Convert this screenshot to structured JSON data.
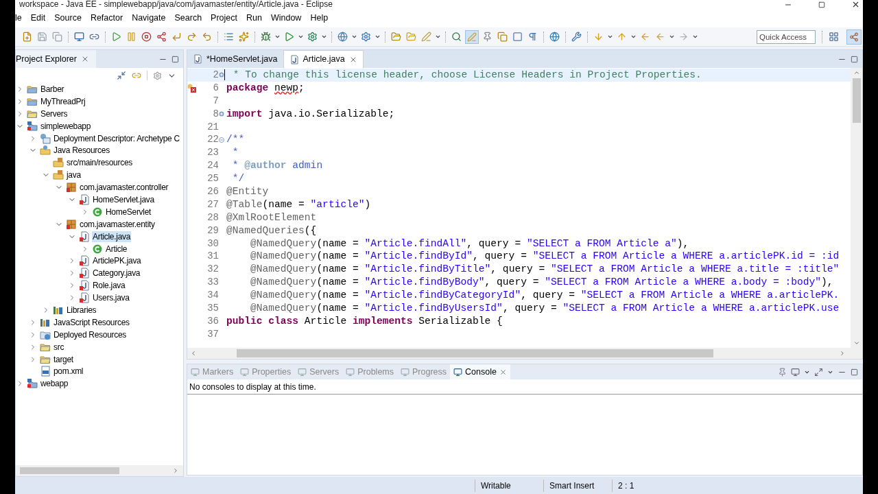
{
  "window": {
    "title": "workspace - Java EE - simplewebapp/java/com/javamaster/entity/Article.java - Eclipse"
  },
  "menu": [
    "le",
    "Edit",
    "Source",
    "Refactor",
    "Navigate",
    "Search",
    "Project",
    "Run",
    "Window",
    "Help"
  ],
  "toolbar": {
    "quick_access": {
      "placeholder": "Quick Access"
    },
    "toggle_buttons": [
      {
        "on": true
      },
      {
        "on": true
      }
    ]
  },
  "project_explorer": {
    "title": "Project Explorer",
    "tree": [
      {
        "label": "Barber",
        "kind": "project",
        "expanded": false,
        "selected": false
      },
      {
        "label": "MyThreadPrj",
        "kind": "project",
        "expanded": false,
        "selected": false
      },
      {
        "label": "Servers",
        "kind": "folder",
        "expanded": false,
        "selected": false
      },
      {
        "label": "simplewebapp",
        "kind": "web-project",
        "expanded": true,
        "selected": false,
        "children": [
          {
            "label": "Deployment Descriptor: Archetype C",
            "kind": "descriptor",
            "expanded": false,
            "selected": false
          },
          {
            "label": "Java Resources",
            "kind": "resources",
            "expanded": true,
            "selected": false,
            "children": [
              {
                "label": "src/main/resources",
                "kind": "source-folder",
                "selected": false
              },
              {
                "label": "java",
                "kind": "source-folder",
                "expanded": true,
                "selected": false,
                "children": [
                  {
                    "label": "com.javamaster.controller",
                    "kind": "package",
                    "expanded": true,
                    "selected": false,
                    "children": [
                      {
                        "label": "HomeServlet.java",
                        "kind": "java-file",
                        "expanded": true,
                        "selected": false,
                        "children": [
                          {
                            "label": "HomeServlet",
                            "kind": "class",
                            "expanded": false,
                            "selected": false
                          }
                        ]
                      }
                    ]
                  },
                  {
                    "label": "com.javamaster.entity",
                    "kind": "package",
                    "expanded": true,
                    "selected": false,
                    "children": [
                      {
                        "label": "Article.java",
                        "kind": "java-file",
                        "expanded": true,
                        "selected": true,
                        "children": [
                          {
                            "label": "Article",
                            "kind": "class",
                            "expanded": false,
                            "selected": false
                          }
                        ]
                      },
                      {
                        "label": "ArticlePK.java",
                        "kind": "java-file",
                        "expanded": false,
                        "selected": false
                      },
                      {
                        "label": "Category.java",
                        "kind": "java-file",
                        "expanded": false,
                        "selected": false
                      },
                      {
                        "label": "Role.java",
                        "kind": "java-file",
                        "expanded": false,
                        "selected": false
                      },
                      {
                        "label": "Users.java",
                        "kind": "java-file",
                        "expanded": false,
                        "selected": false
                      }
                    ]
                  }
                ]
              },
              {
                "label": "Libraries",
                "kind": "library",
                "expanded": false,
                "selected": false
              }
            ]
          },
          {
            "label": "JavaScript Resources",
            "kind": "library",
            "expanded": false,
            "selected": false
          },
          {
            "label": "Deployed Resources",
            "kind": "deployed",
            "expanded": false,
            "selected": false
          },
          {
            "label": "src",
            "kind": "folder",
            "expanded": false,
            "selected": false
          },
          {
            "label": "target",
            "kind": "folder",
            "expanded": false,
            "selected": false
          },
          {
            "label": "pom.xml",
            "kind": "xml-file",
            "selected": false
          }
        ]
      },
      {
        "label": "webapp",
        "kind": "web-project",
        "expanded": false,
        "selected": false
      }
    ]
  },
  "editor": {
    "tabs": [
      {
        "label": "*HomeServlet.java",
        "selected": false
      },
      {
        "label": "Article.java",
        "selected": true
      }
    ],
    "lines": [
      {
        "number": "2",
        "folded": true,
        "current": true,
        "error": false,
        "tokens": [
          {
            "kind": "comment",
            "text": " * To change this license header, choose License Headers in Project Properties."
          }
        ]
      },
      {
        "number": "6",
        "current": false,
        "error": true,
        "tokens": [
          {
            "kind": "keyword",
            "text": "package "
          },
          {
            "kind": "misspelled",
            "text": "newp"
          },
          {
            "kind": "plain",
            "text": ";"
          }
        ]
      },
      {
        "number": "7",
        "current": false,
        "error": false
      },
      {
        "number": "8",
        "folded": true,
        "current": false,
        "error": false,
        "tokens": [
          {
            "kind": "keyword",
            "text": "import"
          },
          {
            "kind": "plain",
            "text": " java.io.Serializable;"
          }
        ]
      },
      {
        "number": "21",
        "current": false,
        "error": false
      },
      {
        "number": "22",
        "folded": false,
        "current": false,
        "error": false,
        "tokens": [
          {
            "kind": "doc",
            "text": "/**"
          }
        ]
      },
      {
        "number": "23",
        "current": false,
        "error": false,
        "tokens": [
          {
            "kind": "doc",
            "text": " *"
          }
        ]
      },
      {
        "number": "24",
        "current": false,
        "error": false,
        "tokens": [
          {
            "kind": "doc",
            "text": " * "
          },
          {
            "kind": "doctag",
            "text": "@author"
          },
          {
            "kind": "doc",
            "text": " admin"
          }
        ]
      },
      {
        "number": "25",
        "current": false,
        "error": false,
        "tokens": [
          {
            "kind": "doc",
            "text": " */"
          }
        ]
      },
      {
        "number": "26",
        "current": false,
        "error": false,
        "tokens": [
          {
            "kind": "annotation",
            "text": "@Entity"
          }
        ]
      },
      {
        "number": "27",
        "current": false,
        "error": false,
        "tokens": [
          {
            "kind": "annotation",
            "text": "@Table"
          },
          {
            "kind": "plain",
            "text": "(name = "
          },
          {
            "kind": "string",
            "text": "\"article\""
          },
          {
            "kind": "plain",
            "text": ")"
          }
        ]
      },
      {
        "number": "28",
        "current": false,
        "error": false,
        "tokens": [
          {
            "kind": "annotation",
            "text": "@XmlRootElement"
          }
        ]
      },
      {
        "number": "29",
        "current": false,
        "error": false,
        "tokens": [
          {
            "kind": "annotation",
            "text": "@NamedQueries"
          },
          {
            "kind": "plain",
            "text": "({"
          }
        ]
      },
      {
        "number": "30",
        "current": false,
        "error": false,
        "tokens": [
          {
            "kind": "annotation",
            "text": "    @NamedQuery"
          },
          {
            "kind": "plain",
            "text": "(name = "
          },
          {
            "kind": "string",
            "text": "\"Article.findAll\""
          },
          {
            "kind": "plain",
            "text": ", query = "
          },
          {
            "kind": "string",
            "text": "\"SELECT a FROM Article a\""
          },
          {
            "kind": "plain",
            "text": "),"
          }
        ]
      },
      {
        "number": "31",
        "current": false,
        "error": false,
        "tokens": [
          {
            "kind": "annotation",
            "text": "    @NamedQuery"
          },
          {
            "kind": "plain",
            "text": "(name = "
          },
          {
            "kind": "string",
            "text": "\"Article.findById\""
          },
          {
            "kind": "plain",
            "text": ", query = "
          },
          {
            "kind": "string",
            "text": "\"SELECT a FROM Article a WHERE a.articlePK.id = :id"
          }
        ]
      },
      {
        "number": "32",
        "current": false,
        "error": false,
        "tokens": [
          {
            "kind": "annotation",
            "text": "    @NamedQuery"
          },
          {
            "kind": "plain",
            "text": "(name = "
          },
          {
            "kind": "string",
            "text": "\"Article.findByTitle\""
          },
          {
            "kind": "plain",
            "text": ", query = "
          },
          {
            "kind": "string",
            "text": "\"SELECT a FROM Article a WHERE a.title = :title\""
          }
        ]
      },
      {
        "number": "33",
        "current": false,
        "error": false,
        "tokens": [
          {
            "kind": "annotation",
            "text": "    @NamedQuery"
          },
          {
            "kind": "plain",
            "text": "(name = "
          },
          {
            "kind": "string",
            "text": "\"Article.findByBody\""
          },
          {
            "kind": "plain",
            "text": ", query = "
          },
          {
            "kind": "string",
            "text": "\"SELECT a FROM Article a WHERE a.body = :body\""
          },
          {
            "kind": "plain",
            "text": "),"
          }
        ]
      },
      {
        "number": "34",
        "current": false,
        "error": false,
        "tokens": [
          {
            "kind": "annotation",
            "text": "    @NamedQuery"
          },
          {
            "kind": "plain",
            "text": "(name = "
          },
          {
            "kind": "string",
            "text": "\"Article.findByCategoryId\""
          },
          {
            "kind": "plain",
            "text": ", query = "
          },
          {
            "kind": "string",
            "text": "\"SELECT a FROM Article a WHERE a.articlePK."
          }
        ]
      },
      {
        "number": "35",
        "current": false,
        "error": false,
        "tokens": [
          {
            "kind": "annotation",
            "text": "    @NamedQuery"
          },
          {
            "kind": "plain",
            "text": "(name = "
          },
          {
            "kind": "string",
            "text": "\"Article.findByUsersId\""
          },
          {
            "kind": "plain",
            "text": ", query = "
          },
          {
            "kind": "string",
            "text": "\"SELECT a FROM Article a WHERE a.articlePK.use"
          }
        ]
      },
      {
        "number": "36",
        "current": false,
        "error": false,
        "tokens": [
          {
            "kind": "keyword",
            "text": "public "
          },
          {
            "kind": "keyword",
            "text": "class"
          },
          {
            "kind": "plain",
            "text": " Article "
          },
          {
            "kind": "keyword",
            "text": "implements"
          },
          {
            "kind": "plain",
            "text": " Serializable {"
          }
        ]
      },
      {
        "number": "37",
        "current": false,
        "error": false
      }
    ]
  },
  "console": {
    "tabs": [
      {
        "label": "Markers",
        "selected": false
      },
      {
        "label": "Properties",
        "selected": false
      },
      {
        "label": "Servers",
        "selected": false
      },
      {
        "label": "Problems",
        "selected": false
      },
      {
        "label": "Progress",
        "selected": false
      },
      {
        "label": "Console",
        "selected": true
      }
    ],
    "message": "No consoles to display at this time."
  },
  "status_bar": [
    "Writable",
    "Smart Insert",
    "2 : 1"
  ]
}
